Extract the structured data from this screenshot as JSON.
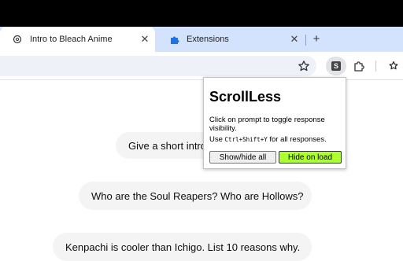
{
  "tabs": [
    {
      "title": "Intro to Bleach Anime",
      "active": true,
      "icon": "openai-logo-icon"
    },
    {
      "title": "Extensions",
      "active": false,
      "icon": "puzzle-icon"
    }
  ],
  "tab_close_glyph": "✕",
  "new_tab_glyph": "+",
  "toolbar": {
    "extension_letter": "S"
  },
  "popup": {
    "title": "ScrollLess",
    "description": "Click on prompt to toggle response visibility.",
    "usage_prefix": "Use ",
    "usage_shortcut": "Ctrl+Shift+Y",
    "usage_suffix": " for all responses.",
    "show_hide_all_label": "Show/hide all",
    "hide_on_load_label": "Hide on load",
    "hide_on_load_color": "#adff2f"
  },
  "prompts": [
    "Give a short intro",
    "Who are the Soul Reapers? Who are Hollows?",
    "Kenpachi is cooler than Ichigo. List 10 reasons why."
  ],
  "colors": {
    "tabstrip": "#d3e3fd",
    "bubble": "#f4f4f4",
    "window_frame": "#000000"
  }
}
